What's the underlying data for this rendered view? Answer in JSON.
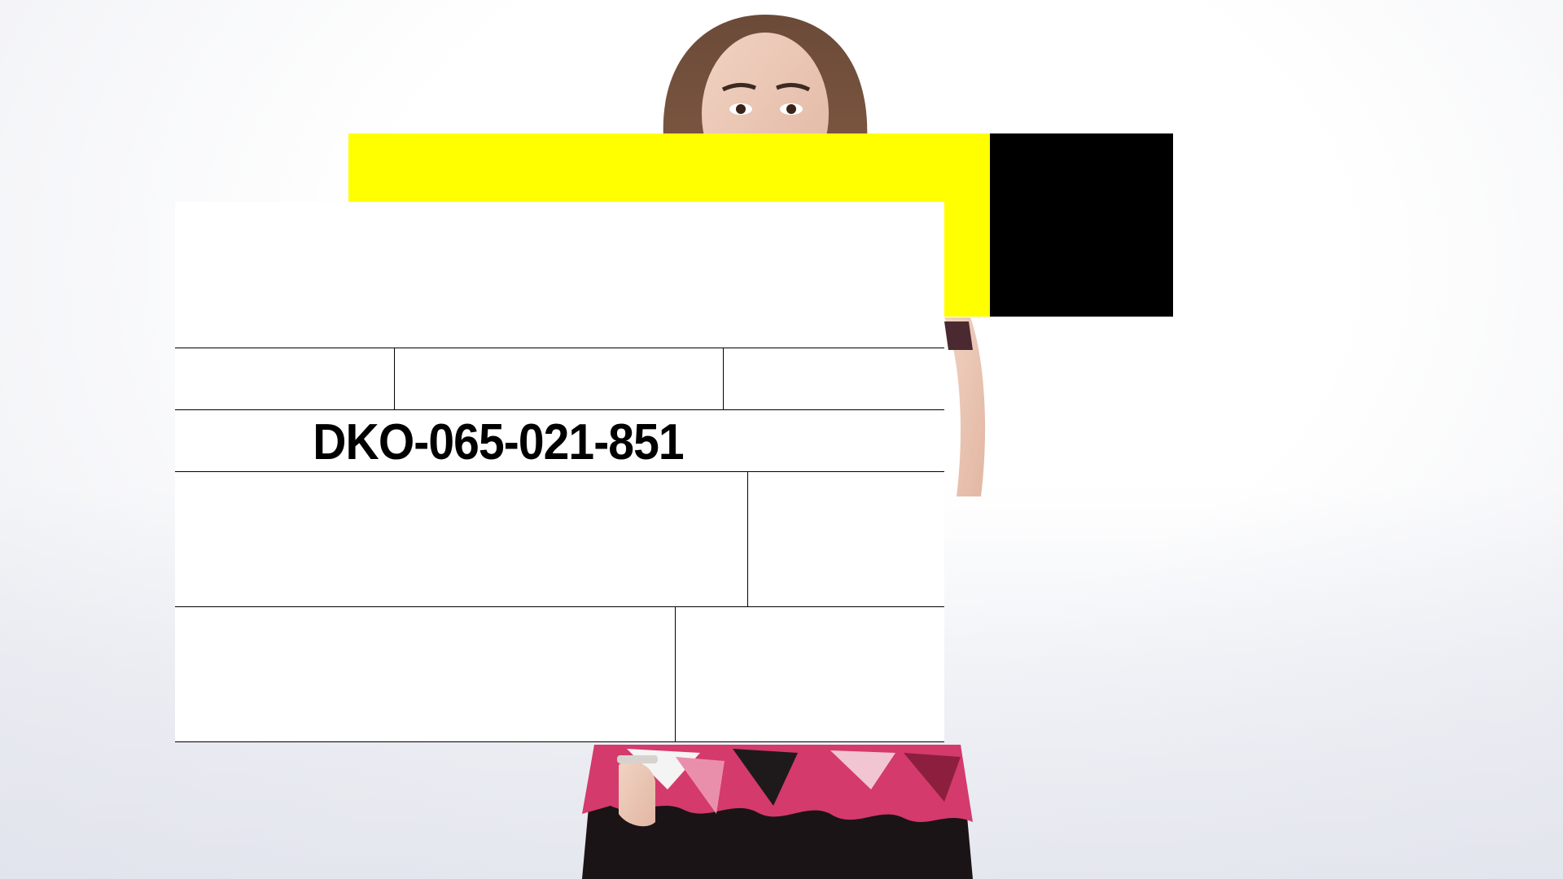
{
  "label": {
    "code": "DKO-065-021-851"
  },
  "colors": {
    "accent_yellow": "#ffff00",
    "block_black": "#000000",
    "rule_lines": "#000000",
    "card_background": "#ffffff"
  }
}
